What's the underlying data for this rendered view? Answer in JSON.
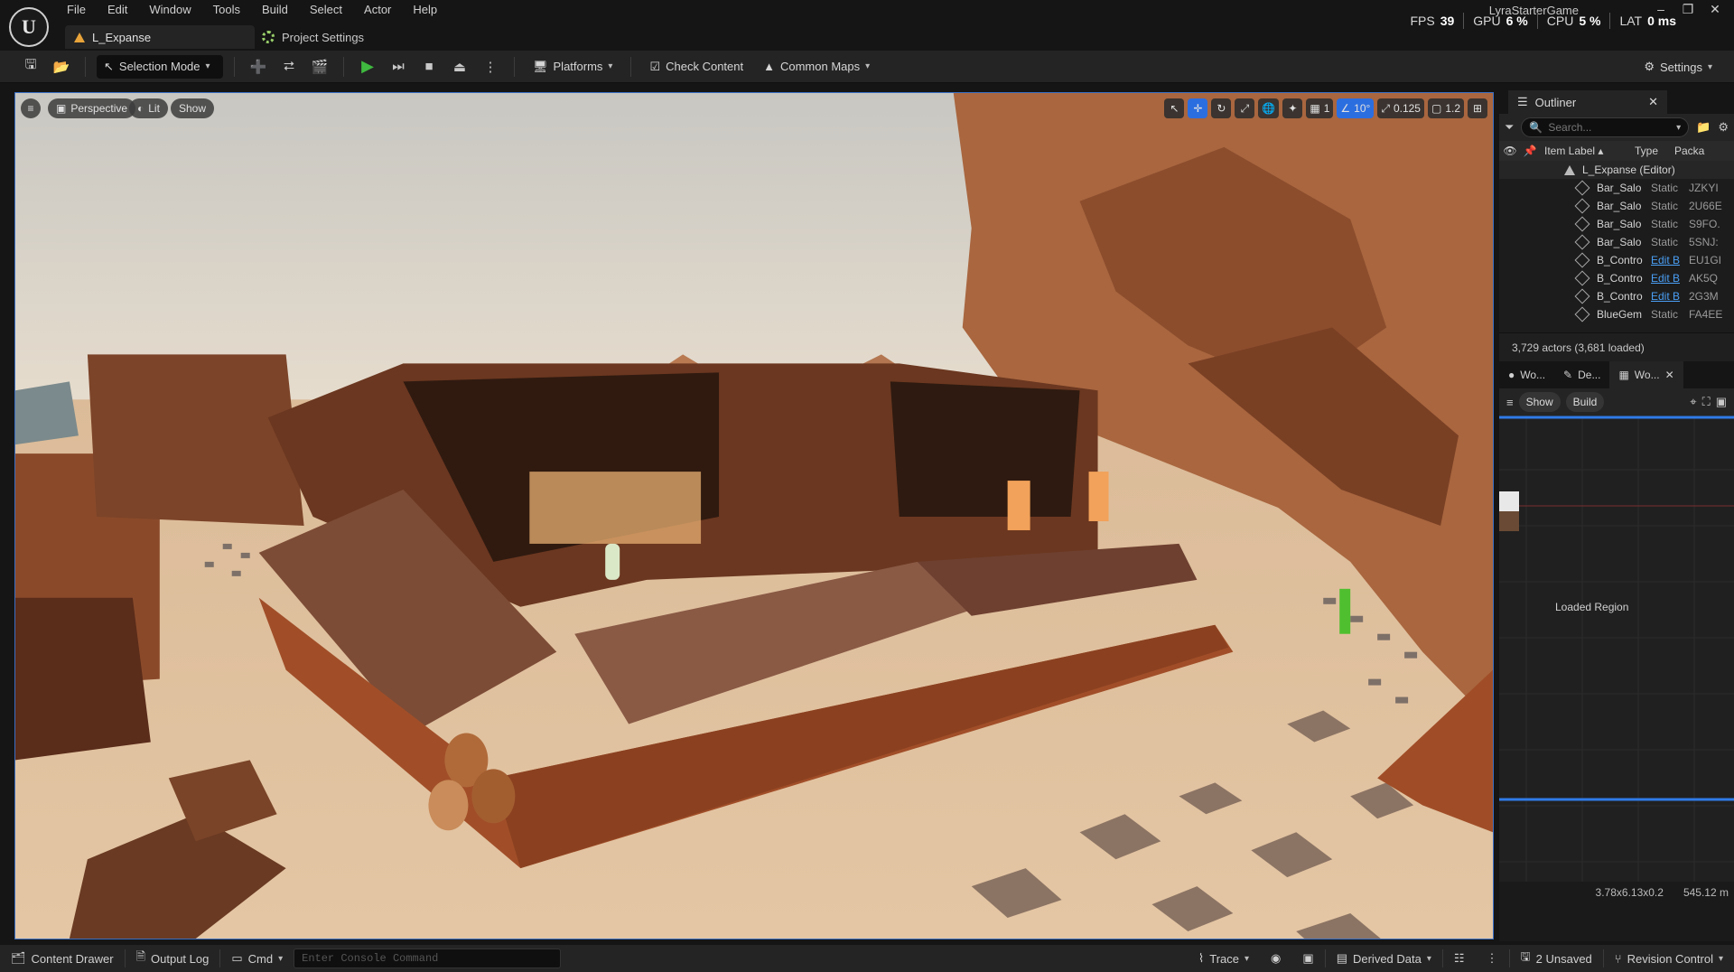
{
  "app": {
    "menu": [
      "File",
      "Edit",
      "Window",
      "Tools",
      "Build",
      "Select",
      "Actor",
      "Help"
    ],
    "doc_tab": "L_Expanse",
    "project_settings_tab": "Project Settings",
    "project_name": "LyraStarterGame",
    "stats": {
      "fps_label": "FPS",
      "fps": "39",
      "gpu_label": "GPU",
      "gpu": "6 %",
      "cpu_label": "CPU",
      "cpu": "5 %",
      "lat_label": "LAT",
      "lat": "0 ms"
    },
    "window_controls": [
      "–",
      "❐",
      "✕"
    ]
  },
  "toolbar": {
    "selection_mode": "Selection Mode",
    "platforms": "Platforms",
    "check_content": "Check Content",
    "common_maps": "Common Maps",
    "settings": "Settings"
  },
  "viewport": {
    "perspective": "Perspective",
    "lit": "Lit",
    "show": "Show",
    "grid_snap": "1",
    "angle_snap": "10°",
    "scale_snap": "0.125",
    "camera_speed": "1.2"
  },
  "outliner": {
    "title": "Outliner",
    "search_placeholder": "Search...",
    "columns": {
      "label": "Item Label ▴",
      "type": "Type",
      "package": "Packa"
    },
    "root": "L_Expanse (Editor)",
    "rows": [
      {
        "label": "Bar_Salo",
        "type": "Static",
        "pkg": "JZKYI",
        "link": false
      },
      {
        "label": "Bar_Salo",
        "type": "Static",
        "pkg": "2U66E",
        "link": false
      },
      {
        "label": "Bar_Salo",
        "type": "Static",
        "pkg": "S9FO.",
        "link": false
      },
      {
        "label": "Bar_Salo",
        "type": "Static",
        "pkg": "5SNJ:",
        "link": false
      },
      {
        "label": "B_Contro",
        "type": "Edit B",
        "pkg": "EU1GI",
        "link": true
      },
      {
        "label": "B_Contro",
        "type": "Edit B",
        "pkg": "AK5Q",
        "link": true
      },
      {
        "label": "B_Contro",
        "type": "Edit B",
        "pkg": "2G3M",
        "link": true
      },
      {
        "label": "BlueGem",
        "type": "Static",
        "pkg": "FA4EE",
        "link": false
      }
    ],
    "count": "3,729 actors (3,681 loaded)"
  },
  "world_partition": {
    "tabs": [
      "Wo...",
      "De...",
      "Wo..."
    ],
    "show": "Show",
    "build": "Build",
    "region_label": "Loaded Region",
    "size": "3.78x6.13x0.2",
    "distance": "545.12 m"
  },
  "statusbar": {
    "content_drawer": "Content Drawer",
    "output_log": "Output Log",
    "cmd": "Cmd",
    "console_placeholder": "Enter Console Command",
    "trace": "Trace",
    "derived_data": "Derived Data",
    "unsaved": "2 Unsaved",
    "revision_control": "Revision Control"
  }
}
